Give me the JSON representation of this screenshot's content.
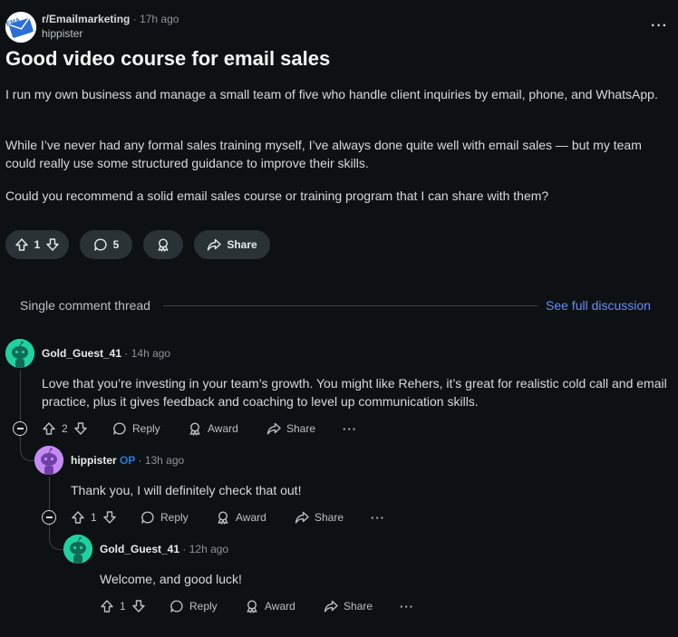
{
  "post": {
    "subreddit": "r/Emailmarketing",
    "time": "17h ago",
    "author": "hippister",
    "title": "Good video course for email sales",
    "paragraphs": [
      "I run my own business and manage a small team of five who handle client inquiries by email, phone, and WhatsApp.",
      "While I’ve never had any formal sales training myself, I’ve always done quite well with email sales — but my team could really use some structured guidance to improve their skills.",
      "Could you recommend a solid email sales course or training program that I can share with them?"
    ],
    "votes": "1",
    "comments": "5",
    "share_label": "Share",
    "more": "···"
  },
  "thread": {
    "label": "Single comment thread",
    "see_full": "See full discussion"
  },
  "comments": [
    {
      "user": "Gold_Guest_41",
      "op": "",
      "time": "14h ago",
      "text": "Love that you’re investing in your team’s growth. You might like Rehers, it’s great for realistic cold call and email practice, plus it gives feedback and coaching to level up communication skills.",
      "votes": "2",
      "reply": "Reply",
      "award": "Award",
      "share": "Share",
      "more": "···",
      "avatar_color": "#1fd1a1"
    },
    {
      "user": "hippister",
      "op": "OP",
      "time": "13h ago",
      "text": "Thank you, I will definitely check that out!",
      "votes": "1",
      "reply": "Reply",
      "award": "Award",
      "share": "Share",
      "more": "···",
      "avatar_color": "#c48bf5"
    },
    {
      "user": "Gold_Guest_41",
      "op": "",
      "time": "12h ago",
      "text": "Welcome, and good luck!",
      "votes": "1",
      "reply": "Reply",
      "award": "Award",
      "share": "Share",
      "more": "···",
      "avatar_color": "#1fd1a1"
    }
  ],
  "colors": {
    "background": "#0e1113",
    "pill": "#2a3236",
    "link": "#648efc",
    "op_badge": "#1f7fe0"
  }
}
